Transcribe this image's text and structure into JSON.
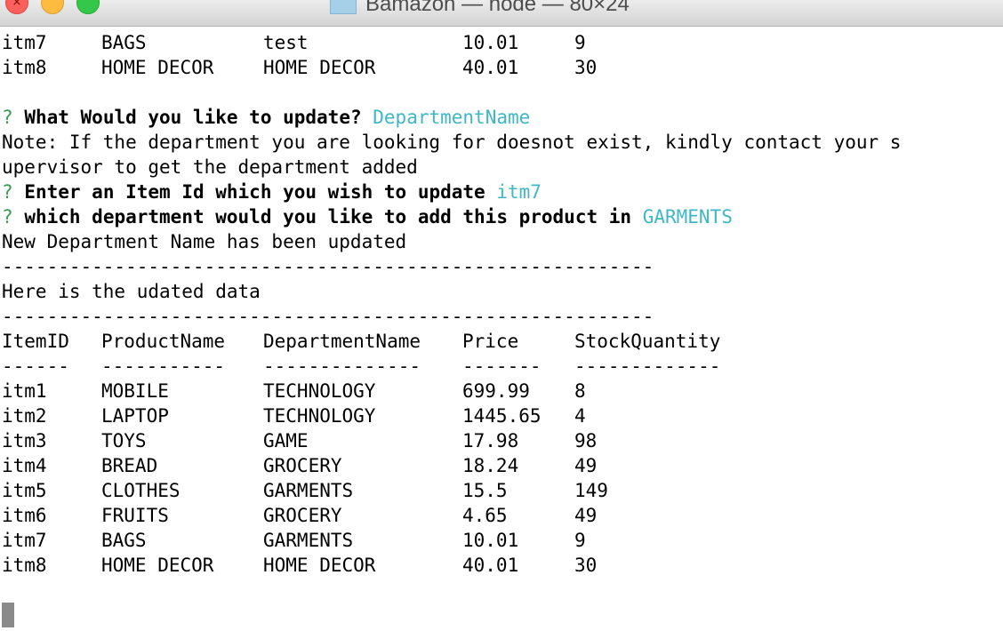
{
  "window": {
    "title": "Bamazon — node — 80×24",
    "close_glyph": "×",
    "title_icon": "folder-icon"
  },
  "colors": {
    "prompt_question_mark": "#3a9b53",
    "prompt_answer": "#3eb7c6",
    "text": "#000000",
    "cursor": "#8a8a8a"
  },
  "terminal": {
    "top_rows": [
      [
        "itm7",
        "BAGS",
        "test",
        "10.01",
        "9"
      ],
      [
        "itm8",
        "HOME DECOR",
        "HOME DECOR",
        "40.01",
        "30"
      ]
    ],
    "prompt1": {
      "mark": "?",
      "question": "What Would you like to update?",
      "answer": "DepartmentName"
    },
    "note_line1": "Note: If the department you are looking for doesnot exist, kindly contact your s",
    "note_line2": "upervisor to get the department added",
    "prompt2": {
      "mark": "?",
      "question": "Enter an Item Id which you wish to update",
      "answer": "itm7"
    },
    "prompt3": {
      "mark": "?",
      "question": "which department would you like to add this product in",
      "answer": "GARMENTS"
    },
    "updated_message": "New Department Name has been updated",
    "separator": "----------------------------------------------------------",
    "data_heading": "Here is the udated data",
    "table": {
      "headers": [
        "ItemID",
        "ProductName",
        "DepartmentName",
        "Price",
        "StockQuantity"
      ],
      "underlines": [
        "------",
        "-----------",
        "--------------",
        "-------",
        "-------------"
      ],
      "rows": [
        [
          "itm1",
          "MOBILE",
          "TECHNOLOGY",
          "699.99",
          "8"
        ],
        [
          "itm2",
          "LAPTOP",
          "TECHNOLOGY",
          "1445.65",
          "4"
        ],
        [
          "itm3",
          "TOYS",
          "GAME",
          "17.98",
          "98"
        ],
        [
          "itm4",
          "BREAD",
          "GROCERY",
          "18.24",
          "49"
        ],
        [
          "itm5",
          "CLOTHES",
          "GARMENTS",
          "15.5",
          "149"
        ],
        [
          "itm6",
          "FRUITS",
          "GROCERY",
          "4.65",
          "49"
        ],
        [
          "itm7",
          "BAGS",
          "GARMENTS",
          "10.01",
          "9"
        ],
        [
          "itm8",
          "HOME DECOR",
          "HOME DECOR",
          "40.01",
          "30"
        ]
      ]
    }
  }
}
